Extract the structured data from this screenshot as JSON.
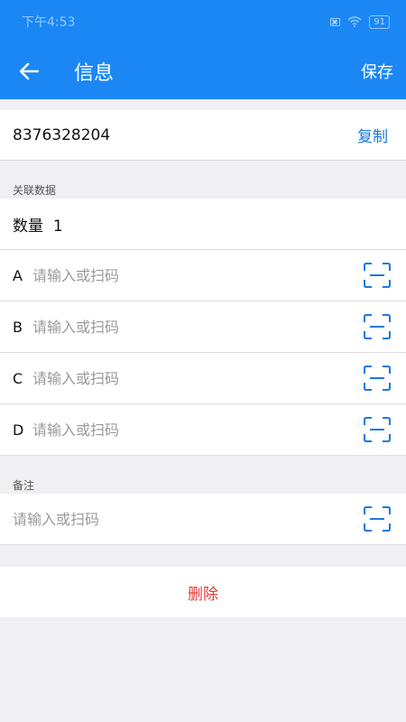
{
  "statusbar": {
    "time": "下午4:53",
    "battery": "91"
  },
  "toolbar": {
    "title": "信息",
    "save_label": "保存"
  },
  "code": {
    "value": "8376328204",
    "copy_label": "复制"
  },
  "related": {
    "section_label": "关联数据",
    "quantity_label": "数量",
    "quantity_value": "1",
    "fields": [
      {
        "letter": "A",
        "placeholder": "请输入或扫码"
      },
      {
        "letter": "B",
        "placeholder": "请输入或扫码"
      },
      {
        "letter": "C",
        "placeholder": "请输入或扫码"
      },
      {
        "letter": "D",
        "placeholder": "请输入或扫码"
      }
    ]
  },
  "remark": {
    "section_label": "备注",
    "placeholder": "请输入或扫码"
  },
  "delete_label": "删除",
  "colors": {
    "primary": "#1a87f5",
    "link": "#1a78e0",
    "danger": "#e53935",
    "background": "#efeff4"
  }
}
